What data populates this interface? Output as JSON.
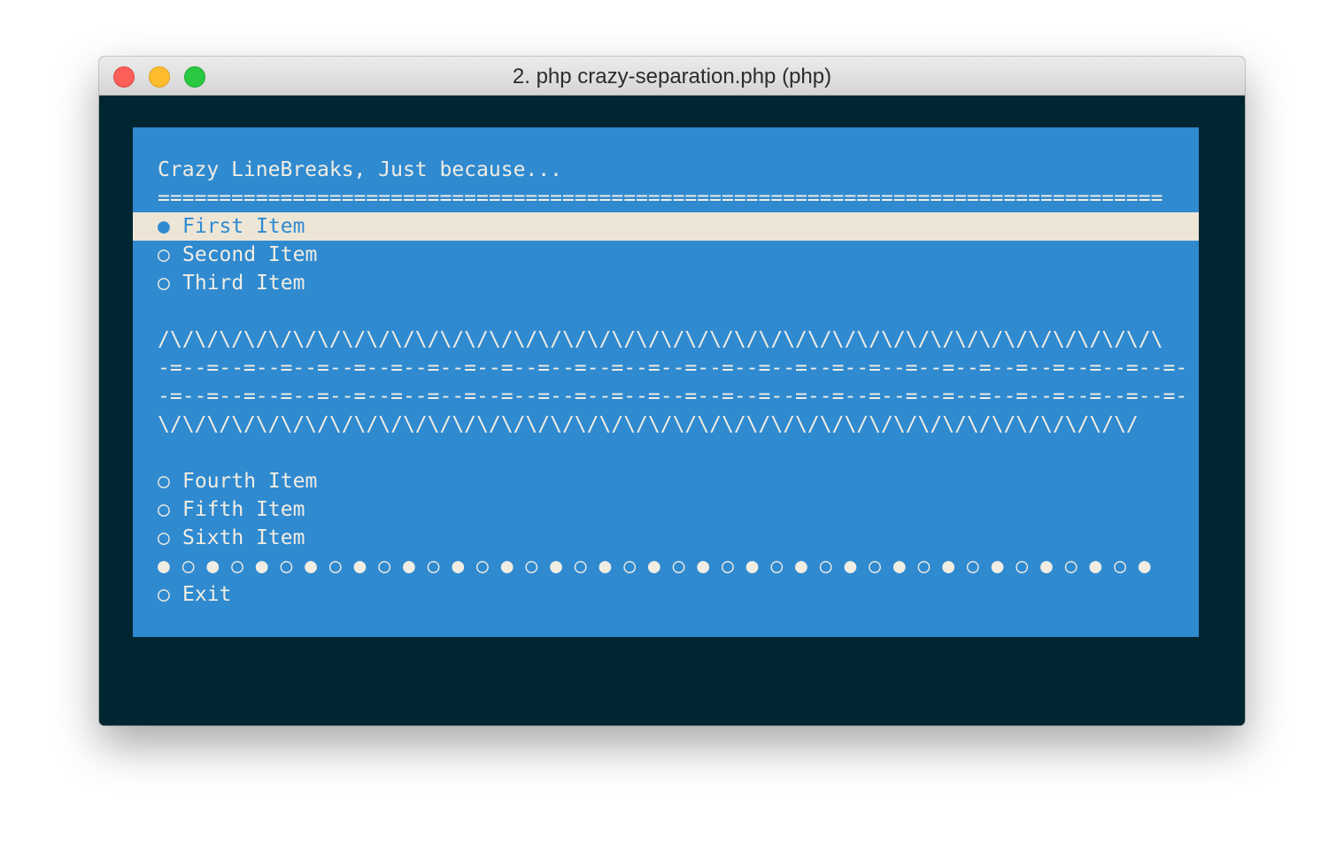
{
  "window": {
    "title": "2. php crazy-separation.php (php)"
  },
  "colors": {
    "terminal_bg": "#002731",
    "menu_bg": "#2f8ad0",
    "menu_fg": "#f1ede3",
    "selected_bg": "#ede6d6",
    "selected_fg": "#2f8ad0"
  },
  "menu": {
    "title": "Crazy LineBreaks, Just because...",
    "title_rule": "==================================================================================",
    "items_group1": [
      {
        "marker": "●",
        "label": "First Item",
        "selected": true
      },
      {
        "marker": "○",
        "label": "Second Item",
        "selected": false
      },
      {
        "marker": "○",
        "label": "Third Item",
        "selected": false
      }
    ],
    "separators": [
      "/\\/\\/\\/\\/\\/\\/\\/\\/\\/\\/\\/\\/\\/\\/\\/\\/\\/\\/\\/\\/\\/\\/\\/\\/\\/\\/\\/\\/\\/\\/\\/\\/\\/\\/\\/\\/\\/\\/\\/\\/\\",
      "-=--=--=--=--=--=--=--=--=--=--=--=--=--=--=--=--=--=--=--=--=--=--=--=--=--=--=--=-",
      "-=--=--=--=--=--=--=--=--=--=--=--=--=--=--=--=--=--=--=--=--=--=--=--=--=--=--=--=-",
      "\\/\\/\\/\\/\\/\\/\\/\\/\\/\\/\\/\\/\\/\\/\\/\\/\\/\\/\\/\\/\\/\\/\\/\\/\\/\\/\\/\\/\\/\\/\\/\\/\\/\\/\\/\\/\\/\\/\\/\\/"
    ],
    "items_group2": [
      {
        "marker": "○",
        "label": "Fourth Item"
      },
      {
        "marker": "○",
        "label": "Fifth Item"
      },
      {
        "marker": "○",
        "label": "Sixth Item"
      }
    ],
    "dot_separator": "● ○ ● ○ ● ○ ● ○ ● ○ ● ○ ● ○ ● ○ ● ○ ● ○ ● ○ ● ○ ● ○ ● ○ ● ○ ● ○ ● ○ ● ○ ● ○ ● ○ ●",
    "exit": {
      "marker": "○",
      "label": "Exit"
    }
  }
}
